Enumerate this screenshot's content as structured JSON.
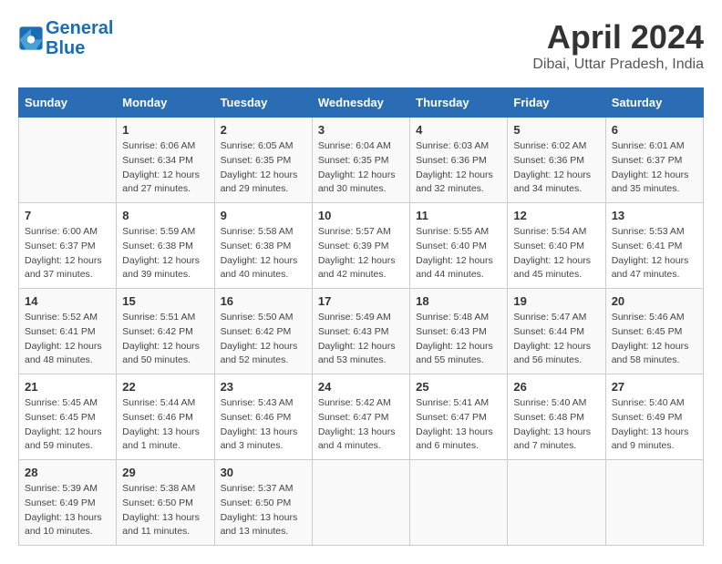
{
  "header": {
    "logo_line1": "General",
    "logo_line2": "Blue",
    "month_year": "April 2024",
    "location": "Dibai, Uttar Pradesh, India"
  },
  "weekdays": [
    "Sunday",
    "Monday",
    "Tuesday",
    "Wednesday",
    "Thursday",
    "Friday",
    "Saturday"
  ],
  "weeks": [
    [
      {
        "day": "",
        "info": ""
      },
      {
        "day": "1",
        "info": "Sunrise: 6:06 AM\nSunset: 6:34 PM\nDaylight: 12 hours\nand 27 minutes."
      },
      {
        "day": "2",
        "info": "Sunrise: 6:05 AM\nSunset: 6:35 PM\nDaylight: 12 hours\nand 29 minutes."
      },
      {
        "day": "3",
        "info": "Sunrise: 6:04 AM\nSunset: 6:35 PM\nDaylight: 12 hours\nand 30 minutes."
      },
      {
        "day": "4",
        "info": "Sunrise: 6:03 AM\nSunset: 6:36 PM\nDaylight: 12 hours\nand 32 minutes."
      },
      {
        "day": "5",
        "info": "Sunrise: 6:02 AM\nSunset: 6:36 PM\nDaylight: 12 hours\nand 34 minutes."
      },
      {
        "day": "6",
        "info": "Sunrise: 6:01 AM\nSunset: 6:37 PM\nDaylight: 12 hours\nand 35 minutes."
      }
    ],
    [
      {
        "day": "7",
        "info": "Sunrise: 6:00 AM\nSunset: 6:37 PM\nDaylight: 12 hours\nand 37 minutes."
      },
      {
        "day": "8",
        "info": "Sunrise: 5:59 AM\nSunset: 6:38 PM\nDaylight: 12 hours\nand 39 minutes."
      },
      {
        "day": "9",
        "info": "Sunrise: 5:58 AM\nSunset: 6:38 PM\nDaylight: 12 hours\nand 40 minutes."
      },
      {
        "day": "10",
        "info": "Sunrise: 5:57 AM\nSunset: 6:39 PM\nDaylight: 12 hours\nand 42 minutes."
      },
      {
        "day": "11",
        "info": "Sunrise: 5:55 AM\nSunset: 6:40 PM\nDaylight: 12 hours\nand 44 minutes."
      },
      {
        "day": "12",
        "info": "Sunrise: 5:54 AM\nSunset: 6:40 PM\nDaylight: 12 hours\nand 45 minutes."
      },
      {
        "day": "13",
        "info": "Sunrise: 5:53 AM\nSunset: 6:41 PM\nDaylight: 12 hours\nand 47 minutes."
      }
    ],
    [
      {
        "day": "14",
        "info": "Sunrise: 5:52 AM\nSunset: 6:41 PM\nDaylight: 12 hours\nand 48 minutes."
      },
      {
        "day": "15",
        "info": "Sunrise: 5:51 AM\nSunset: 6:42 PM\nDaylight: 12 hours\nand 50 minutes."
      },
      {
        "day": "16",
        "info": "Sunrise: 5:50 AM\nSunset: 6:42 PM\nDaylight: 12 hours\nand 52 minutes."
      },
      {
        "day": "17",
        "info": "Sunrise: 5:49 AM\nSunset: 6:43 PM\nDaylight: 12 hours\nand 53 minutes."
      },
      {
        "day": "18",
        "info": "Sunrise: 5:48 AM\nSunset: 6:43 PM\nDaylight: 12 hours\nand 55 minutes."
      },
      {
        "day": "19",
        "info": "Sunrise: 5:47 AM\nSunset: 6:44 PM\nDaylight: 12 hours\nand 56 minutes."
      },
      {
        "day": "20",
        "info": "Sunrise: 5:46 AM\nSunset: 6:45 PM\nDaylight: 12 hours\nand 58 minutes."
      }
    ],
    [
      {
        "day": "21",
        "info": "Sunrise: 5:45 AM\nSunset: 6:45 PM\nDaylight: 12 hours\nand 59 minutes."
      },
      {
        "day": "22",
        "info": "Sunrise: 5:44 AM\nSunset: 6:46 PM\nDaylight: 13 hours\nand 1 minute."
      },
      {
        "day": "23",
        "info": "Sunrise: 5:43 AM\nSunset: 6:46 PM\nDaylight: 13 hours\nand 3 minutes."
      },
      {
        "day": "24",
        "info": "Sunrise: 5:42 AM\nSunset: 6:47 PM\nDaylight: 13 hours\nand 4 minutes."
      },
      {
        "day": "25",
        "info": "Sunrise: 5:41 AM\nSunset: 6:47 PM\nDaylight: 13 hours\nand 6 minutes."
      },
      {
        "day": "26",
        "info": "Sunrise: 5:40 AM\nSunset: 6:48 PM\nDaylight: 13 hours\nand 7 minutes."
      },
      {
        "day": "27",
        "info": "Sunrise: 5:40 AM\nSunset: 6:49 PM\nDaylight: 13 hours\nand 9 minutes."
      }
    ],
    [
      {
        "day": "28",
        "info": "Sunrise: 5:39 AM\nSunset: 6:49 PM\nDaylight: 13 hours\nand 10 minutes."
      },
      {
        "day": "29",
        "info": "Sunrise: 5:38 AM\nSunset: 6:50 PM\nDaylight: 13 hours\nand 11 minutes."
      },
      {
        "day": "30",
        "info": "Sunrise: 5:37 AM\nSunset: 6:50 PM\nDaylight: 13 hours\nand 13 minutes."
      },
      {
        "day": "",
        "info": ""
      },
      {
        "day": "",
        "info": ""
      },
      {
        "day": "",
        "info": ""
      },
      {
        "day": "",
        "info": ""
      }
    ]
  ]
}
